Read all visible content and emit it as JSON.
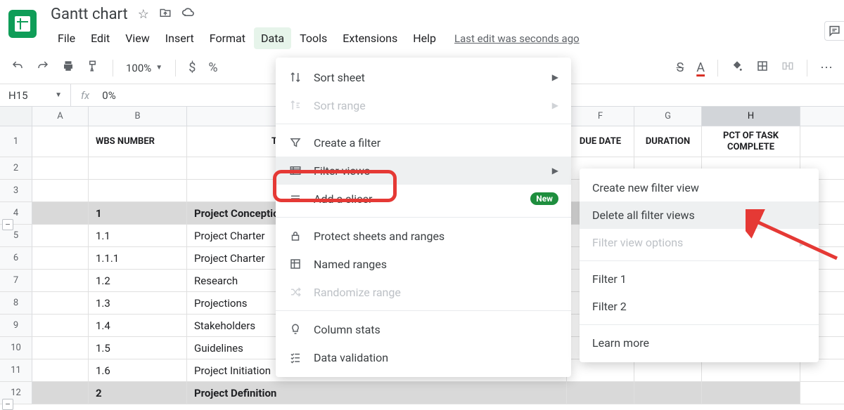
{
  "doc": {
    "title": "Gantt chart"
  },
  "menus": {
    "file": "File",
    "edit": "Edit",
    "view": "View",
    "insert": "Insert",
    "format": "Format",
    "data": "Data",
    "tools": "Tools",
    "extensions": "Extensions",
    "help": "Help",
    "last_edit": "Last edit was seconds ago"
  },
  "toolbar": {
    "zoom": "100%",
    "currency": "$",
    "percent": "%",
    "strike": "S",
    "textcolor": "A"
  },
  "formula": {
    "cell": "H15",
    "value": "0%"
  },
  "columns": {
    "A": "A",
    "B": "B",
    "F": "F",
    "G": "G",
    "H": "H"
  },
  "headers": {
    "B": "WBS NUMBER",
    "C": "TASK TITLE",
    "F": "DUE DATE",
    "G": "DURATION",
    "H": "PCT OF TASK COMPLETE"
  },
  "rows": [
    {
      "n": "1",
      "b": "",
      "c": ""
    },
    {
      "n": "2",
      "b": "",
      "c": ""
    },
    {
      "n": "3",
      "b": "",
      "c": ""
    },
    {
      "n": "4",
      "b": "1",
      "c": "Project Conception",
      "section": true
    },
    {
      "n": "5",
      "b": "1.1",
      "c": "Project Charter"
    },
    {
      "n": "6",
      "b": "1.1.1",
      "c": "Project Charter"
    },
    {
      "n": "7",
      "b": "1.2",
      "c": "Research"
    },
    {
      "n": "8",
      "b": "1.3",
      "c": "Projections"
    },
    {
      "n": "9",
      "b": "1.4",
      "c": "Stakeholders"
    },
    {
      "n": "10",
      "b": "1.5",
      "c": "Guidelines"
    },
    {
      "n": "11",
      "b": "1.6",
      "c": "Project Initiation"
    },
    {
      "n": "12",
      "b": "2",
      "c": "Project Definition",
      "section": true
    }
  ],
  "data_menu": {
    "sort_sheet": "Sort sheet",
    "sort_range": "Sort range",
    "create_filter": "Create a filter",
    "filter_views": "Filter views",
    "add_slicer": "Add a slicer",
    "new_badge": "New",
    "protect": "Protect sheets and ranges",
    "named_ranges": "Named ranges",
    "randomize": "Randomize range",
    "column_stats": "Column stats",
    "data_validation": "Data validation"
  },
  "filter_submenu": {
    "create": "Create new filter view",
    "delete_all": "Delete all filter views",
    "options": "Filter view options",
    "f1": "Filter 1",
    "f2": "Filter 2",
    "learn": "Learn more"
  },
  "collapse_glyph": "–"
}
